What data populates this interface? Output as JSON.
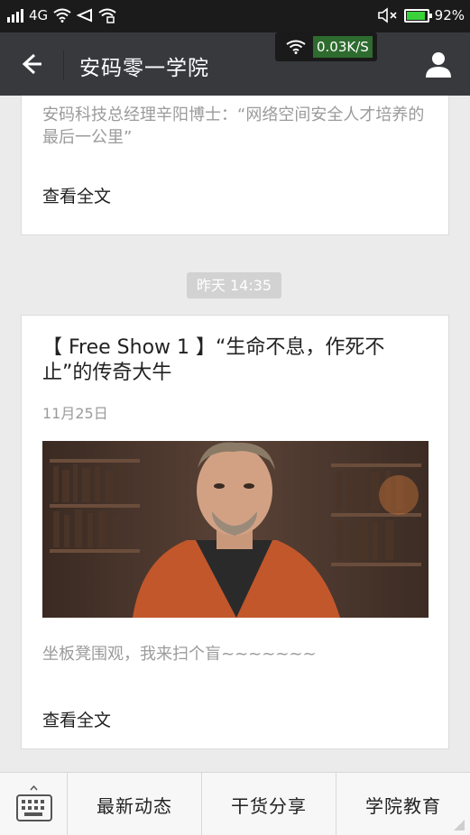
{
  "status_bar": {
    "network": "4G",
    "battery": "92%",
    "battery_level": 0.92
  },
  "header": {
    "title": "安码零一学院",
    "back_icon": "arrow-left-icon",
    "profile_icon": "person-icon"
  },
  "net_speed": {
    "value": "0.03K/S"
  },
  "feed": {
    "card1": {
      "summary": "安码科技总经理辛阳博士：“网络空间安全人才培养的最后一公里”",
      "read_all": "查看全文"
    },
    "time_badge": "昨天 14:35",
    "card2": {
      "headline": "【 Free Show 1 】“生命不息，作死不止”的传奇大牛",
      "date": "11月25日",
      "summary": "坐板凳围观，我来扫个盲~~~~~~~",
      "read_all": "查看全文"
    }
  },
  "bottom_menu": {
    "keyboard_icon": "keyboard-icon",
    "items": [
      {
        "label": "最新动态"
      },
      {
        "label": "干货分享"
      },
      {
        "label": "学院教育"
      }
    ]
  },
  "colors": {
    "header_bg": "#38393d",
    "status_bg": "#1b1b1b",
    "page_bg": "#ebebeb"
  }
}
